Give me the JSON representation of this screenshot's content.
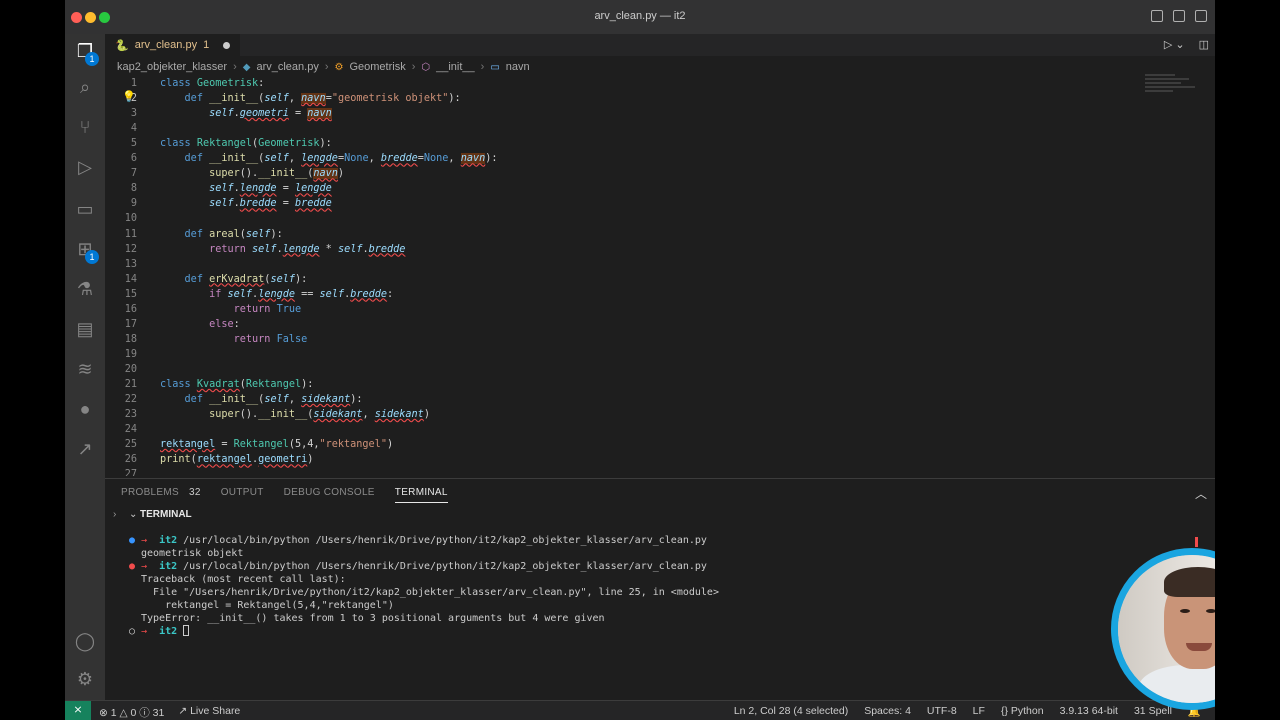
{
  "window": {
    "title": "arv_clean.py — it2"
  },
  "tab": {
    "icon": "python-icon",
    "name": "arv_clean.py",
    "count": "1"
  },
  "breadcrumb": [
    "kap2_objekter_klasser",
    "arv_clean.py",
    "Geometrisk",
    "__init__",
    "navn"
  ],
  "activity": {
    "explorer_badge": "1",
    "extensions_badge": "1"
  },
  "code_lines": [
    {
      "n": "1",
      "html": "<span class='k'>class</span> <span class='c'>Geometrisk</span>:"
    },
    {
      "n": "2",
      "html": "    <span class='k'>def</span> <span class='f'>__init__</span>(<span class='p'>self</span>, <span class='p hl sq'>navn</span>=<span class='s'>\"geometrisk objekt\"</span>):"
    },
    {
      "n": "3",
      "html": "        <span class='p'>self</span>.<span class='p sq'>geometri</span> = <span class='p hl sq'>navn</span>"
    },
    {
      "n": "4",
      "html": ""
    },
    {
      "n": "5",
      "html": "<span class='k'>class</span> <span class='c'>Rektangel</span>(<span class='c'>Geometrisk</span>):"
    },
    {
      "n": "6",
      "html": "    <span class='k'>def</span> <span class='f'>__init__</span>(<span class='p'>self</span>, <span class='p sq'>lengde</span>=<span class='k'>None</span>, <span class='p sq'>bredde</span>=<span class='k'>None</span>, <span class='p hl sq'>navn</span>):"
    },
    {
      "n": "7",
      "html": "        <span class='f'>super</span>().<span class='f'>__init__</span>(<span class='p hl sq'>navn</span>)"
    },
    {
      "n": "8",
      "html": "        <span class='p'>self</span>.<span class='p sq'>lengde</span> = <span class='p sq'>lengde</span>"
    },
    {
      "n": "9",
      "html": "        <span class='p'>self</span>.<span class='p sq'>bredde</span> = <span class='p sq'>bredde</span>"
    },
    {
      "n": "10",
      "html": ""
    },
    {
      "n": "11",
      "html": "    <span class='k'>def</span> <span class='f'>areal</span>(<span class='p'>self</span>):"
    },
    {
      "n": "12",
      "html": "        <span class='kc'>return</span> <span class='p'>self</span>.<span class='p sq'>lengde</span> * <span class='p'>self</span>.<span class='p sq'>bredde</span>"
    },
    {
      "n": "13",
      "html": ""
    },
    {
      "n": "14",
      "html": "    <span class='k'>def</span> <span class='f sq'>erKvadrat</span>(<span class='p'>self</span>):"
    },
    {
      "n": "15",
      "html": "        <span class='kc'>if</span> <span class='p'>self</span>.<span class='p sq'>lengde</span> == <span class='p'>self</span>.<span class='p sq'>bredde</span>:"
    },
    {
      "n": "16",
      "html": "            <span class='kc'>return</span> <span class='k'>True</span>"
    },
    {
      "n": "17",
      "html": "        <span class='kc'>else</span>:"
    },
    {
      "n": "18",
      "html": "            <span class='kc'>return</span> <span class='k'>False</span>"
    },
    {
      "n": "19",
      "html": ""
    },
    {
      "n": "20",
      "html": ""
    },
    {
      "n": "21",
      "html": "<span class='k'>class</span> <span class='c sq'>Kvadrat</span>(<span class='c'>Rektangel</span>):"
    },
    {
      "n": "22",
      "html": "    <span class='k'>def</span> <span class='f'>__init__</span>(<span class='p'>self</span>, <span class='p sq'>sidekant</span>):"
    },
    {
      "n": "23",
      "html": "        <span class='f'>super</span>().<span class='f'>__init__</span>(<span class='p sq'>sidekant</span>, <span class='p sq'>sidekant</span>)"
    },
    {
      "n": "24",
      "html": ""
    },
    {
      "n": "25",
      "html": "<span class='p sq' style='font-style:normal'>rektangel</span> = <span class='c'>Rektangel</span>(5,4,<span class='s'>\"rektangel\"</span>)"
    },
    {
      "n": "26",
      "html": "<span class='f'>print</span>(<span class='p sq' style='font-style:normal'>rektangel</span>.<span class='p sq' style='font-style:normal'>geometri</span>)"
    },
    {
      "n": "27",
      "html": ""
    }
  ],
  "panel": {
    "tabs": [
      {
        "label": "PROBLEMS",
        "count": "32"
      },
      {
        "label": "OUTPUT",
        "count": ""
      },
      {
        "label": "DEBUG CONSOLE",
        "count": ""
      },
      {
        "label": "TERMINAL",
        "count": ""
      }
    ],
    "terminal_title": "TERMINAL"
  },
  "terminal": [
    {
      "bullet": "●",
      "kind": "ok",
      "text": "it2 /usr/local/bin/python /Users/henrik/Drive/python/it2/kap2_objekter_klasser/arv_clean.py"
    },
    {
      "bullet": "",
      "kind": "plain",
      "text": "geometrisk objekt"
    },
    {
      "bullet": "●",
      "kind": "err",
      "text": "it2 /usr/local/bin/python /Users/henrik/Drive/python/it2/kap2_objekter_klasser/arv_clean.py"
    },
    {
      "bullet": "",
      "kind": "plain",
      "text": "Traceback (most recent call last):"
    },
    {
      "bullet": "",
      "kind": "plain",
      "text": "  File \"/Users/henrik/Drive/python/it2/kap2_objekter_klasser/arv_clean.py\", line 25, in <module>"
    },
    {
      "bullet": "",
      "kind": "plain",
      "text": "    rektangel = Rektangel(5,4,\"rektangel\")"
    },
    {
      "bullet": "",
      "kind": "plain",
      "text": "TypeError: __init__() takes from 1 to 3 positional arguments but 4 were given"
    },
    {
      "bullet": "○",
      "kind": "prompt",
      "text": "it2"
    }
  ],
  "status": {
    "errors": "1",
    "warnings": "0",
    "infos": "31",
    "live_share": "Live Share",
    "cursor": "Ln 2, Col 28 (4 selected)",
    "spaces": "Spaces: 4",
    "encoding": "UTF-8",
    "eol": "LF",
    "language": "Python",
    "interpreter": "3.9.13 64-bit",
    "spell": "31 Spell"
  }
}
